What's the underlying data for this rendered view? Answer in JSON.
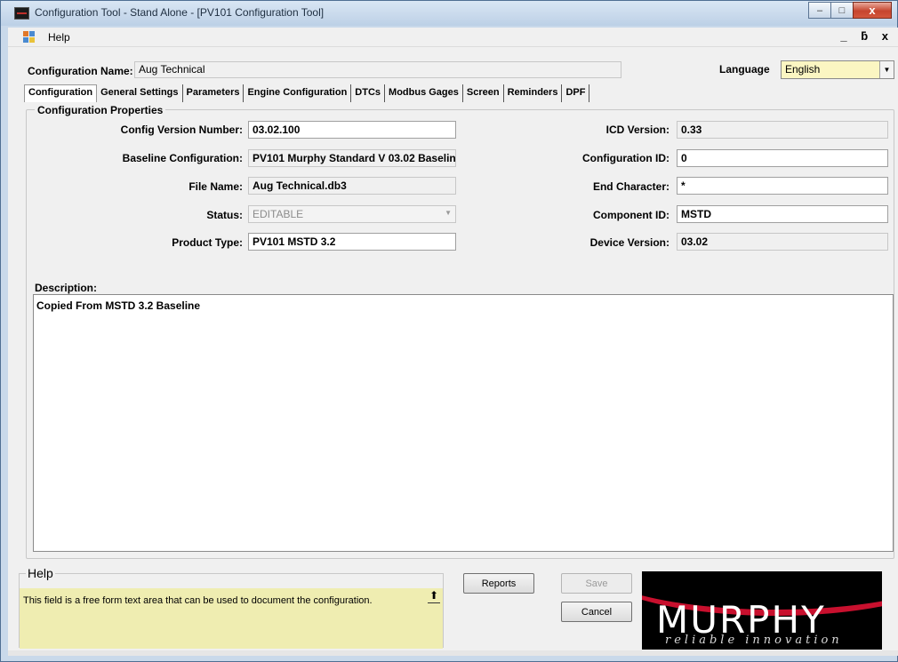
{
  "window": {
    "title": "Configuration Tool - Stand Alone - [PV101 Configuration Tool]",
    "controls": {
      "minimize": "–",
      "maximize": "□",
      "close": "x"
    }
  },
  "menu": {
    "help_label": "Help",
    "mdi_controls": "_ ☐ x",
    "mdi_minimize": "_",
    "mdi_restore": "ᗡ",
    "mdi_close": "x"
  },
  "config_name": {
    "label": "Configuration Name:",
    "value": "Aug Technical"
  },
  "language": {
    "label": "Language",
    "value": "English",
    "arrow": "▼"
  },
  "tabs": [
    {
      "label": "Configuration"
    },
    {
      "label": "General Settings"
    },
    {
      "label": "Parameters"
    },
    {
      "label": "Engine Configuration"
    },
    {
      "label": "DTCs"
    },
    {
      "label": "Modbus Gages"
    },
    {
      "label": "Screen"
    },
    {
      "label": "Reminders"
    },
    {
      "label": "DPF"
    }
  ],
  "properties": {
    "group_title": "Configuration Properties",
    "config_version": {
      "label": "Config Version Number:",
      "value": "03.02.100"
    },
    "baseline": {
      "label": "Baseline Configuration:",
      "value": "PV101 Murphy Standard V 03.02 Baselin"
    },
    "file_name": {
      "label": "File Name:",
      "value": "Aug Technical.db3"
    },
    "status": {
      "label": "Status:",
      "value": "EDITABLE",
      "arrow": "▼"
    },
    "product_type": {
      "label": "Product Type:",
      "value": "PV101 MSTD 3.2"
    },
    "icd_version": {
      "label": "ICD Version:",
      "value": "0.33"
    },
    "configuration_id": {
      "label": "Configuration ID:",
      "value": "0"
    },
    "end_character": {
      "label": "End Character:",
      "value": "*"
    },
    "component_id": {
      "label": "Component ID:",
      "value": "MSTD"
    },
    "device_version": {
      "label": "Device Version:",
      "value": "03.02"
    }
  },
  "description": {
    "label": "Description:",
    "value": "Copied From MSTD 3.2 Baseline"
  },
  "help": {
    "title": "Help",
    "text": "This field is a free form text area that can be used to document the configuration.",
    "arrow": "⬆"
  },
  "buttons": {
    "reports": "Reports",
    "save": "Save",
    "cancel": "Cancel"
  },
  "logo": {
    "name": "MURPHY",
    "tagline": "reliable innovation"
  }
}
